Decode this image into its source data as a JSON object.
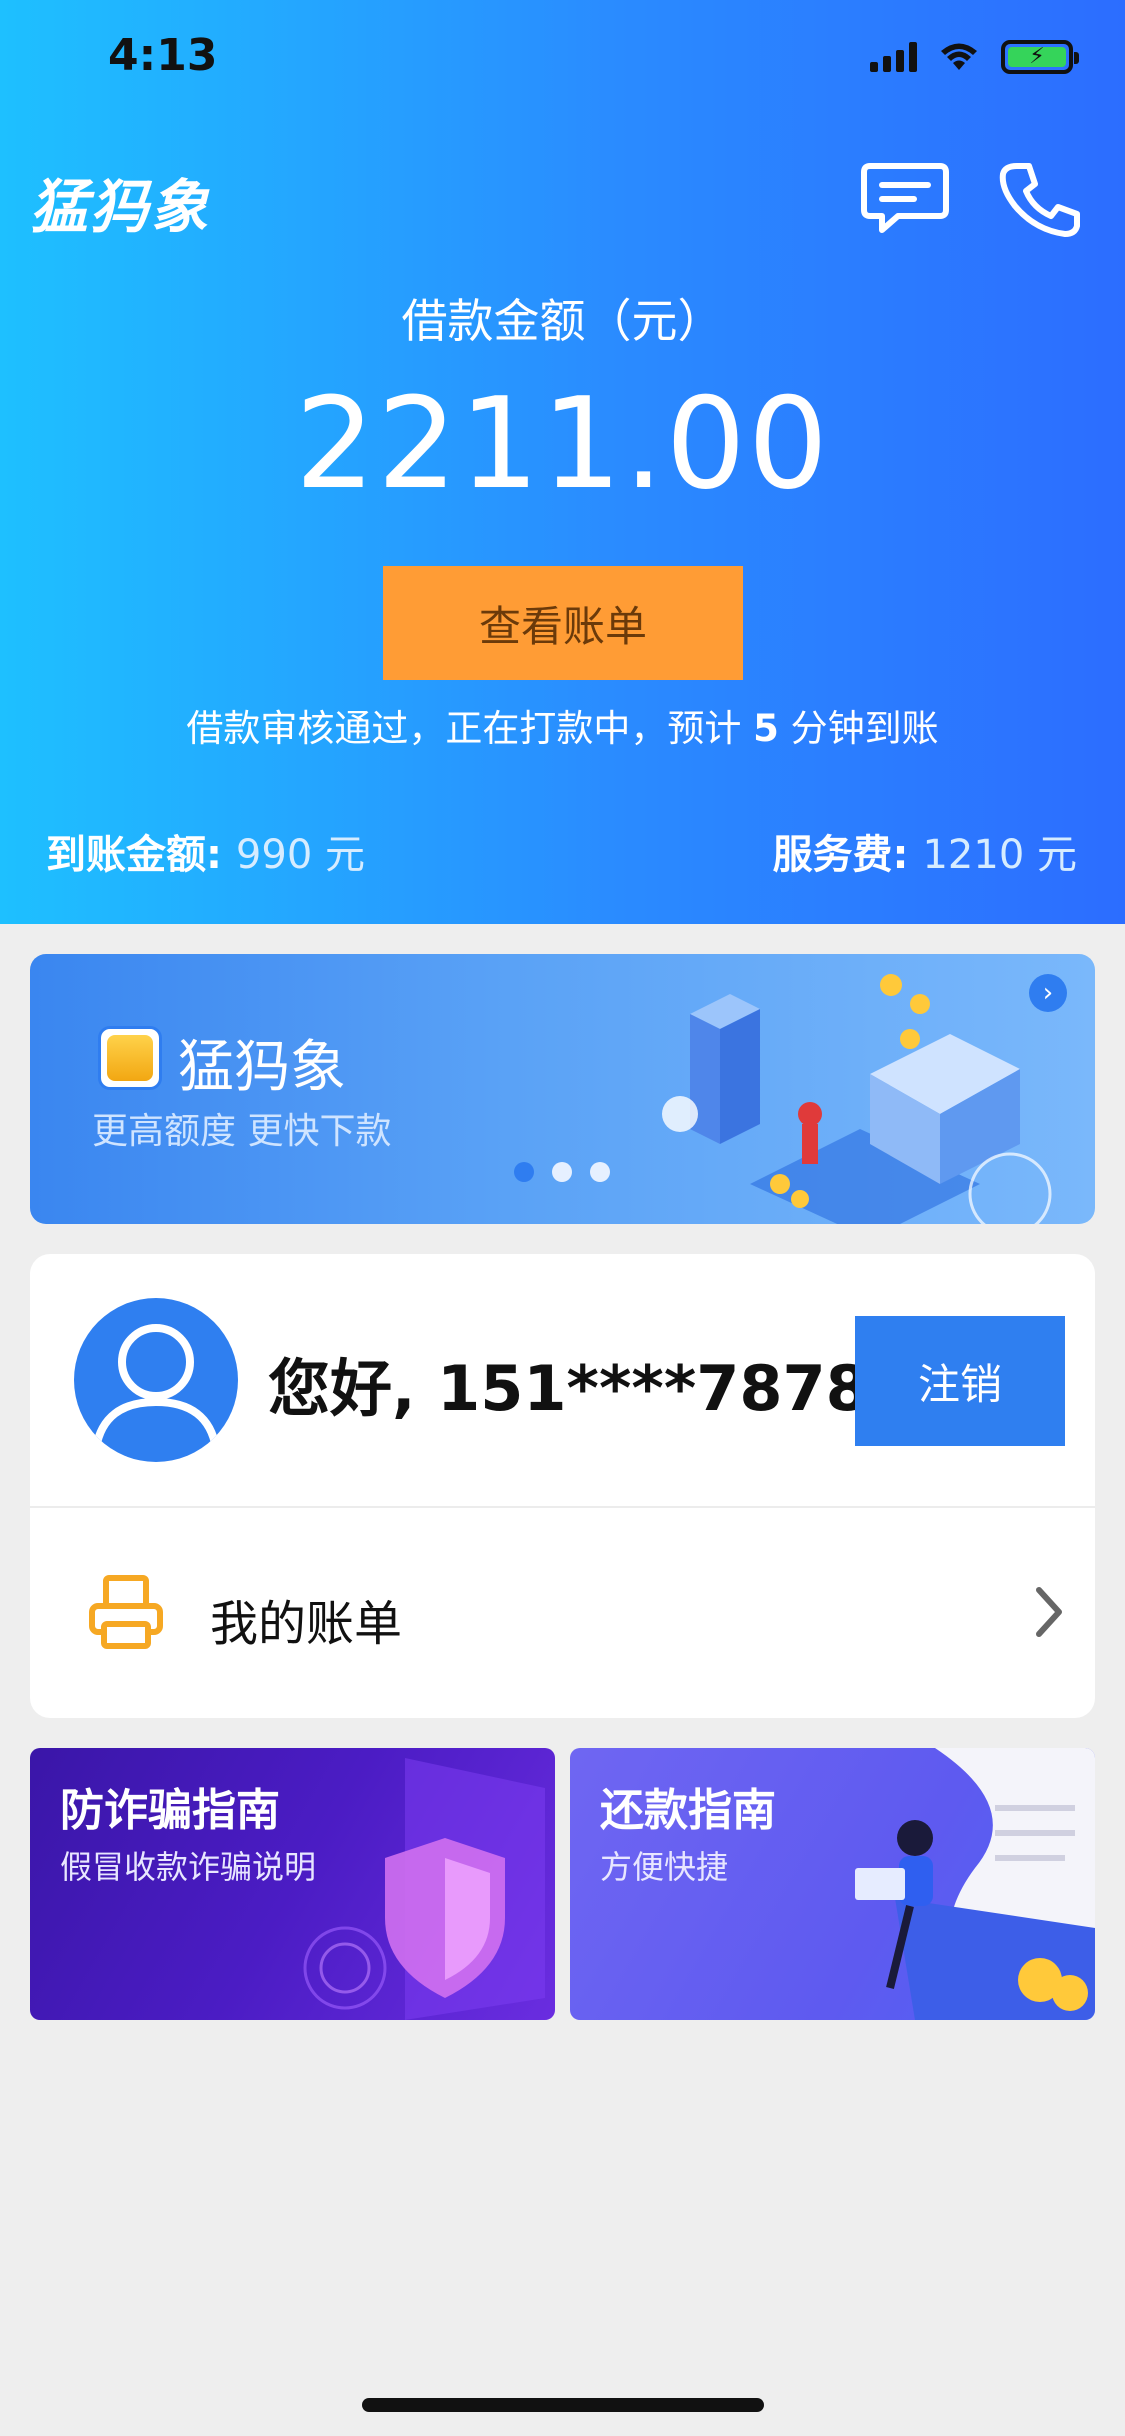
{
  "status_bar": {
    "time": "4:13"
  },
  "header": {
    "app_name": "猛犸象",
    "message_icon": "message-icon",
    "phone_icon": "phone-icon",
    "amount_label": "借款金额（元）",
    "amount_value": "2211.00",
    "bill_button": "查看账单",
    "progress_text_before": "借款审核通过，正在打款中，预计 ",
    "progress_minutes": "5",
    "progress_text_after": " 分钟到账",
    "arrival_key": "到账金额: ",
    "arrival_value": "990 元",
    "fee_key": "服务费: ",
    "fee_value": "1210 元",
    "colors": {
      "gradient_start": "#1ec0ff",
      "gradient_end": "#2c6dff",
      "button": "#ff9c35"
    }
  },
  "banner": {
    "title": "猛犸象",
    "subtitle": "更高额度 更快下款",
    "next_icon": "chevron-right-icon"
  },
  "user_card": {
    "greeting": "您好, 151****7878",
    "logout_button": "注销",
    "bill_item_label": "我的账单",
    "bill_icon": "printer-icon",
    "accent": "#2f7ff0"
  },
  "guides": [
    {
      "title": "防诈骗指南",
      "subtitle": "假冒收款诈骗说明"
    },
    {
      "title": "还款指南",
      "subtitle": "方便快捷"
    }
  ]
}
